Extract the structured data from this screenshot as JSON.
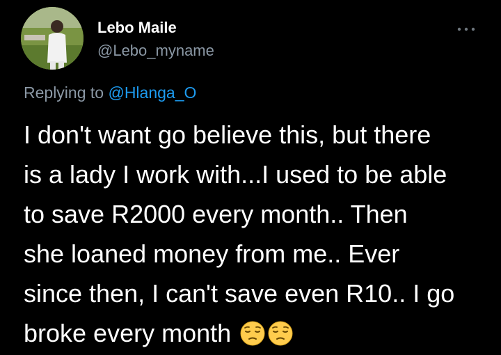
{
  "author": {
    "display_name": "Lebo Maile",
    "handle": "@Lebo_myname"
  },
  "reply": {
    "prefix": "Replying to",
    "mention": "@Hlanga_O"
  },
  "tweet": {
    "lines": [
      "I don't want go believe this, but there",
      "is a lady I work with...I used to be able",
      "to save R2000 every month.. Then",
      "she loaned money from me.. Ever",
      "since then, I can't save even R10.. I go",
      "broke every month"
    ],
    "emojis": [
      "pensive-face",
      "pensive-face"
    ]
  },
  "icons": {
    "more": "more-options-icon",
    "avatar": "profile-photo"
  },
  "colors": {
    "background": "#000000",
    "text": "#ffffff",
    "secondary": "#8b98a5",
    "link": "#1d9bf0"
  }
}
